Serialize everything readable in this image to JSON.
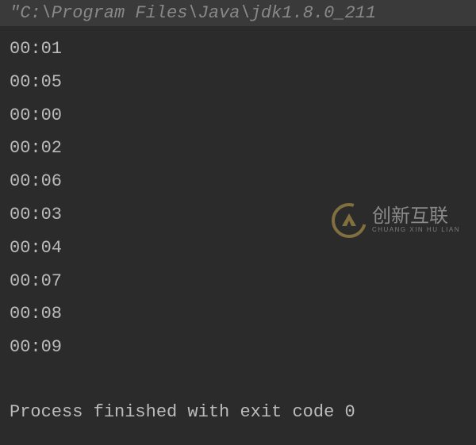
{
  "header": {
    "command": "\"C:\\Program Files\\Java\\jdk1.8.0_211"
  },
  "output": {
    "lines": [
      "00:01",
      "00:05",
      "00:00",
      "00:02",
      "00:06",
      "00:03",
      "00:04",
      "00:07",
      "00:08",
      "00:09"
    ]
  },
  "exit": {
    "message": "Process finished with exit code 0"
  },
  "watermark": {
    "main": "创新互联",
    "sub": "CHUANG XIN HU LIAN"
  }
}
